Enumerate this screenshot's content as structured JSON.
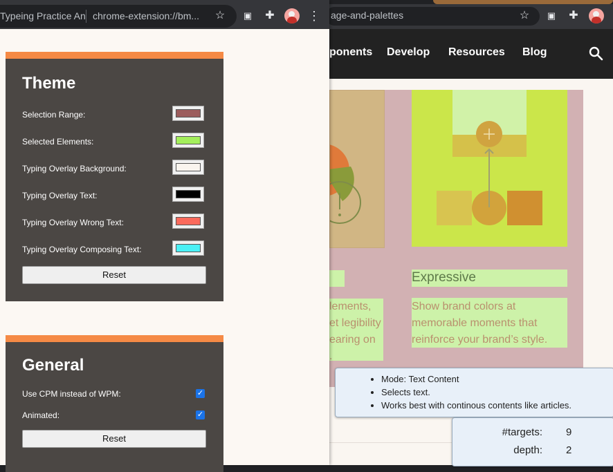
{
  "background_window": {
    "url_text": "age-and-palettes",
    "nav_items": [
      "ponents",
      "Develop",
      "Resources",
      "Blog"
    ],
    "left_card": {
      "text_lines": [
        "lements,",
        "et legibility",
        "earing on",
        "."
      ]
    },
    "right_card": {
      "heading": "Expressive",
      "text_lines": [
        "Show brand colors at",
        "memorable moments that",
        "reinforce your brand’s style."
      ]
    },
    "tooltip": {
      "items": [
        "Mode: Text Content",
        "Selects text.",
        "Works best with continous contents like articles."
      ]
    },
    "stats": {
      "targets_label": "#targets:",
      "targets_value": "9",
      "depth_label": "depth:",
      "depth_value": "2"
    }
  },
  "extension_window": {
    "tab_title": "Typeing Practice An",
    "url_text": "chrome-extension://bm...",
    "theme": {
      "title": "Theme",
      "rows": [
        {
          "label": "Selection Range:",
          "color": "#9c5c5c"
        },
        {
          "label": "Selected Elements:",
          "color": "#a4ef5c"
        },
        {
          "label": "Typing Overlay Background:",
          "color": "#faf5ef"
        },
        {
          "label": "Typing Overlay Text:",
          "color": "#000000"
        },
        {
          "label": "Typing Overlay Wrong Text:",
          "color": "#fb6a5c"
        },
        {
          "label": "Typing Overlay Composing Text:",
          "color": "#4af0f5"
        }
      ],
      "reset_label": "Reset"
    },
    "general": {
      "title": "General",
      "rows": [
        {
          "label": "Use CPM instead of WPM:",
          "checked": true
        },
        {
          "label": "Animated:",
          "checked": true
        }
      ],
      "reset_label": "Reset"
    }
  },
  "colors": {
    "panel_accent": "#f58a45",
    "panel_bg": "#4b4744",
    "nav_bg": "#222222"
  }
}
